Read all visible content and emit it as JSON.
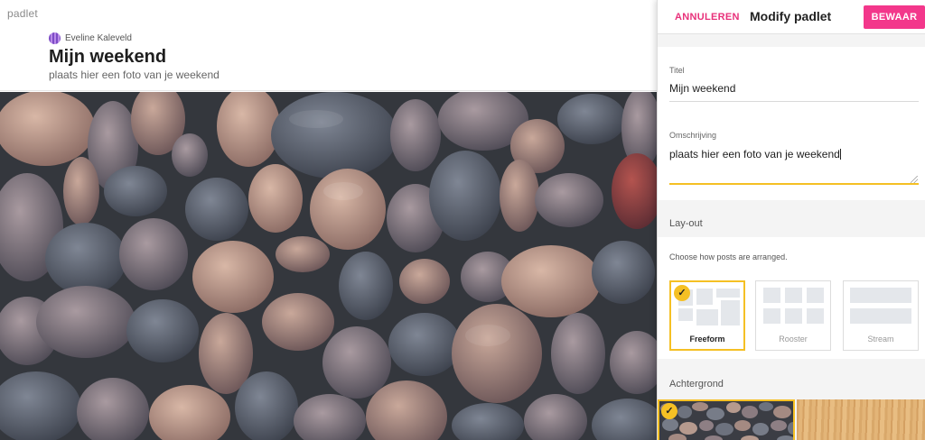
{
  "app": {
    "brand": "padlet"
  },
  "padlet": {
    "author": "Eveline Kaleveld",
    "title": "Mijn weekend",
    "description": "plaats hier een foto van je weekend"
  },
  "panel": {
    "cancel_label": "ANNULEREN",
    "title": "Modify padlet",
    "save_label": "BEWAAR",
    "title_field": {
      "label": "Titel",
      "value": "Mijn weekend"
    },
    "description_field": {
      "label": "Omschrijving",
      "value": "plaats hier een foto van je weekend"
    },
    "layout": {
      "heading": "Lay-out",
      "hint": "Choose how posts are arranged.",
      "options": [
        {
          "label": "Freeform",
          "selected": true
        },
        {
          "label": "Rooster",
          "selected": false
        },
        {
          "label": "Stream",
          "selected": false
        }
      ]
    },
    "background": {
      "heading": "Achtergrond",
      "options": [
        {
          "name": "pebbles",
          "selected": true
        },
        {
          "name": "wood",
          "selected": false
        }
      ]
    }
  },
  "colors": {
    "accent_pink": "#f3378b",
    "cancel_pink": "#e8317a",
    "selection_yellow": "#f5c024"
  },
  "icons": {
    "checkmark": "check-icon"
  }
}
